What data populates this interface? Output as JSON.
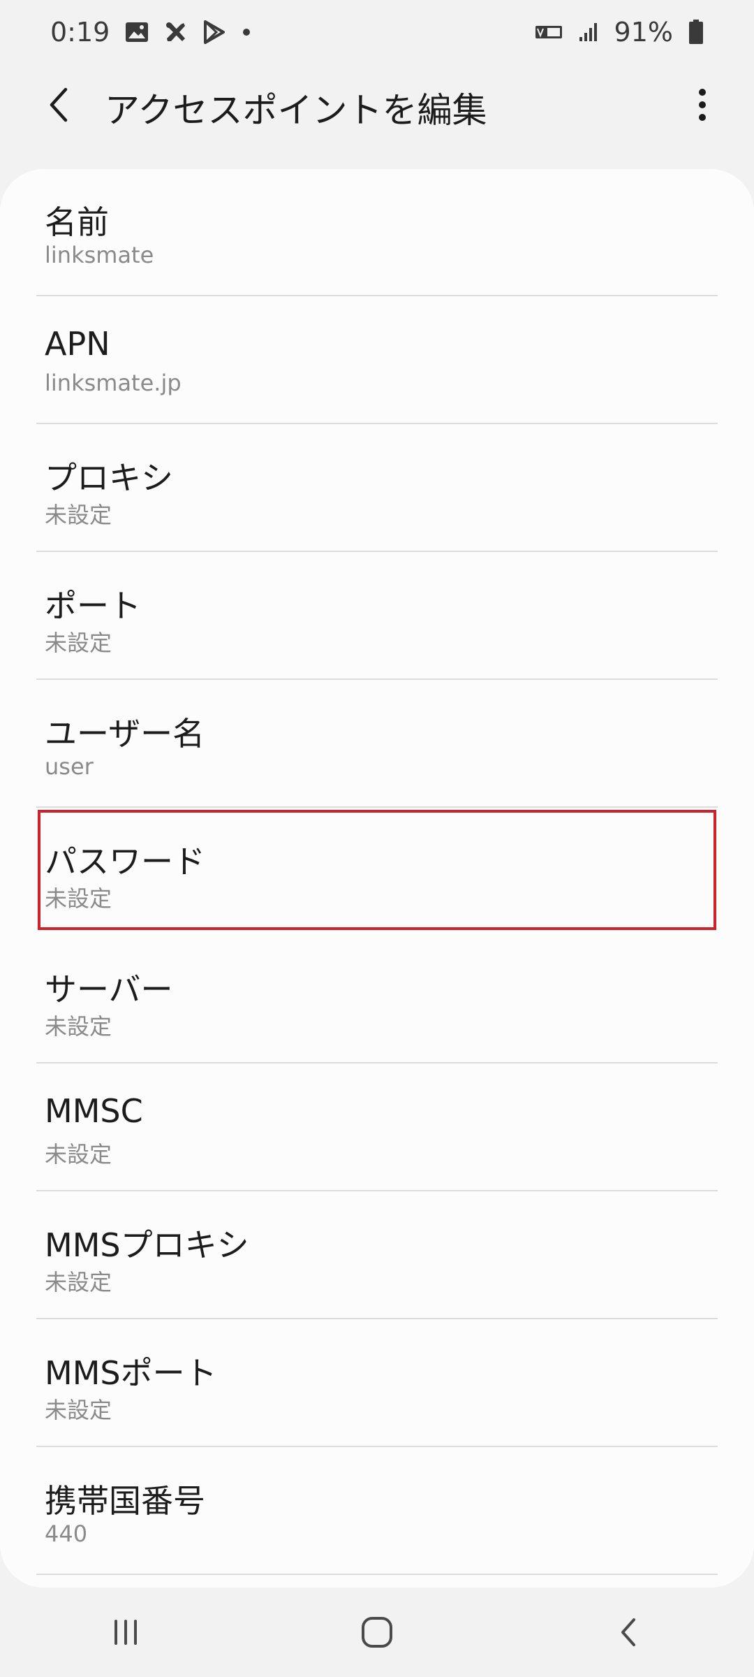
{
  "status_bar": {
    "time": "0:19",
    "battery_percent": "91%",
    "icons": [
      "image-icon",
      "tools-icon",
      "play-store-icon",
      "dot-icon",
      "volte-icon",
      "signal-icon",
      "battery-icon"
    ]
  },
  "app_bar": {
    "title": "アクセスポイントを編集",
    "back_icon": "chevron-left-icon",
    "more_icon": "more-vert-icon"
  },
  "items": [
    {
      "title": "名前",
      "value": "linksmate"
    },
    {
      "title": "APN",
      "value": "linksmate.jp"
    },
    {
      "title": "プロキシ",
      "value": "未設定"
    },
    {
      "title": "ポート",
      "value": "未設定"
    },
    {
      "title": "ユーザー名",
      "value": "user"
    },
    {
      "title": "パスワード",
      "value": "未設定"
    },
    {
      "title": "サーバー",
      "value": "未設定"
    },
    {
      "title": "MMSC",
      "value": "未設定"
    },
    {
      "title": "MMSプロキシ",
      "value": "未設定"
    },
    {
      "title": "MMSポート",
      "value": "未設定"
    },
    {
      "title": "携帯国番号",
      "value": "440"
    }
  ],
  "highlight": {
    "item_index": 5,
    "color": "#d0202a"
  },
  "nav_bar": {
    "icons": [
      "recent-apps-icon",
      "home-icon",
      "back-icon"
    ]
  }
}
